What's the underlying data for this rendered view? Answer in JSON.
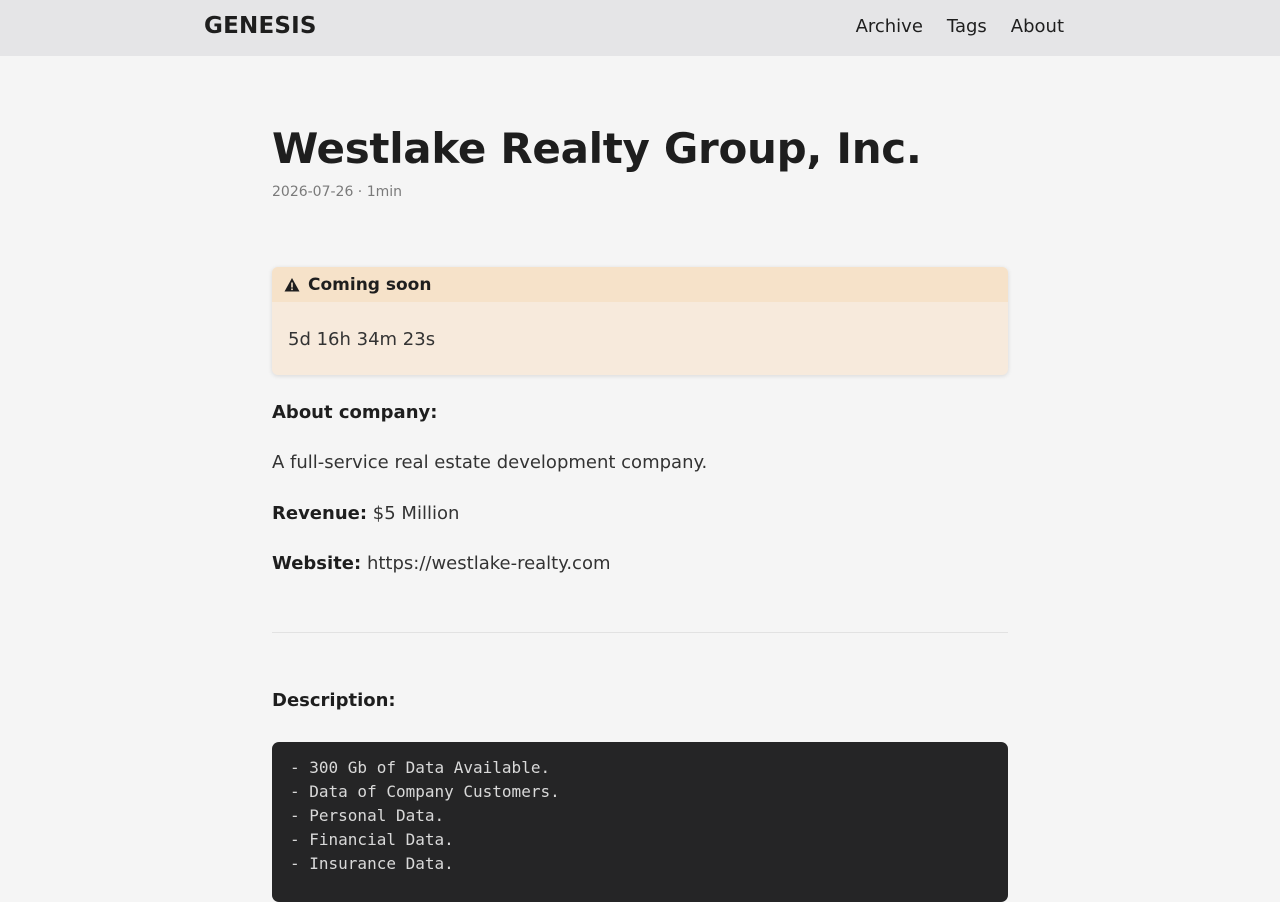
{
  "header": {
    "logo": "GENESIS",
    "nav": [
      "Archive",
      "Tags",
      "About"
    ]
  },
  "post": {
    "title": "Westlake Realty Group, Inc.",
    "meta": "2026-07-26 · 1min"
  },
  "callout": {
    "icon": "warning-icon",
    "title": "Coming soon",
    "countdown": "5d 16h 34m 23s"
  },
  "content": {
    "about_label": "About company:",
    "about_text": "A full-service real estate development company.",
    "revenue_label": "Revenue:",
    "revenue_value": "$5 Million",
    "website_label": "Website:",
    "website_value": "https://westlake-realty.com",
    "description_label": "Description:"
  },
  "code_lines": [
    "- 300 Gb of Data Available.",
    "- Data of Company Customers.",
    "- Personal Data.",
    "- Financial Data.",
    "- Insurance Data."
  ]
}
